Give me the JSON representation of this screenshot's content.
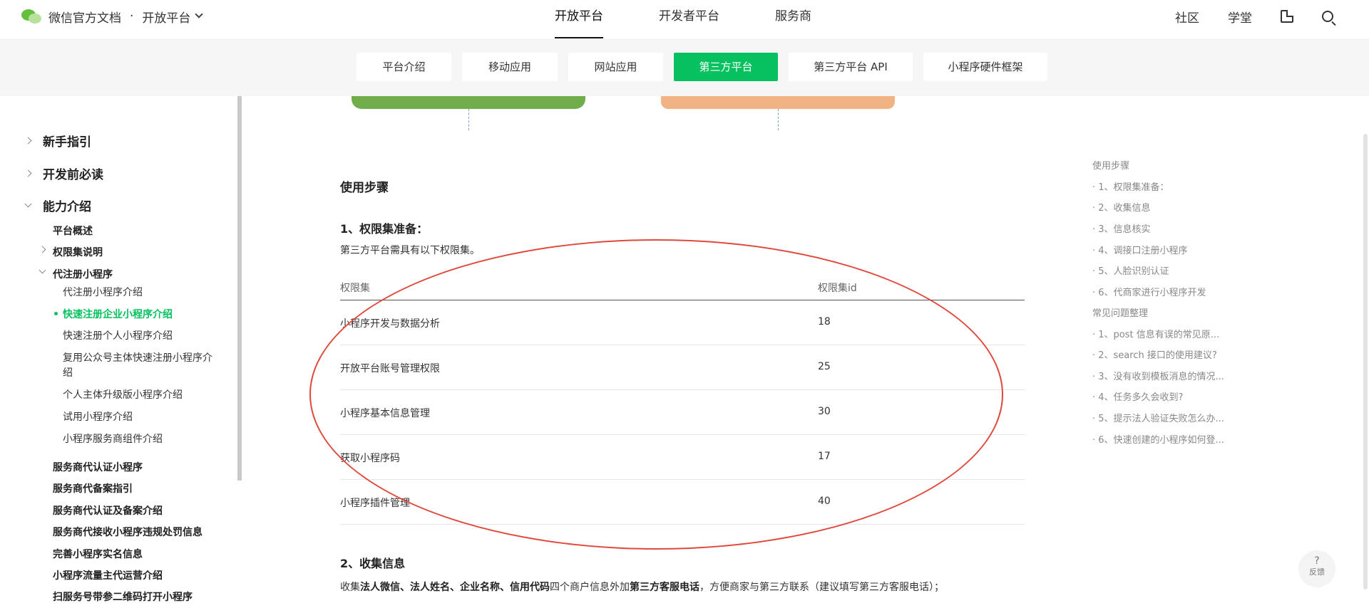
{
  "topnav": {
    "brand": "微信官方文档",
    "separator": "·",
    "platform": "开放平台",
    "main_items": [
      "开放平台",
      "开发者平台",
      "服务商"
    ],
    "right_items": [
      "社区",
      "学堂"
    ]
  },
  "subnav": {
    "tabs": [
      "平台介绍",
      "移动应用",
      "网站应用",
      "第三方平台",
      "第三方平台 API",
      "小程序硬件框架"
    ],
    "active_tab": "第三方平台"
  },
  "sidebar": {
    "top": [
      "新手指引",
      "开发前必读",
      "能力介绍"
    ],
    "ability": [
      "平台概述",
      "权限集说明",
      "代注册小程序"
    ],
    "register_children": [
      "代注册小程序介绍",
      "快速注册企业小程序介绍",
      "快速注册个人小程序介绍",
      "复用公众号主体快速注册小程序介",
      "绍",
      "个人主体升级版小程序介绍",
      "试用小程序介绍",
      "小程序服务商组件介绍"
    ],
    "more": [
      "服务商代认证小程序",
      "服务商代备案指引",
      "服务商代认证及备案介绍",
      "服务商代接收小程序违规处罚信息",
      "完善小程序实名信息",
      "小程序流量主代运营介绍",
      "扫服务号带参二维码打开小程序"
    ]
  },
  "content": {
    "steps_title": "使用步骤",
    "section1_title": "1、权限集准备：",
    "section1_desc": "第三方平台需具有以下权限集。",
    "table": {
      "headers": [
        "权限集",
        "权限集id"
      ],
      "rows": [
        [
          "小程序开发与数据分析",
          "18"
        ],
        [
          "开放平台账号管理权限",
          "25"
        ],
        [
          "小程序基本信息管理",
          "30"
        ],
        [
          "获取小程序码",
          "17"
        ],
        [
          "小程序插件管理",
          "40"
        ]
      ]
    },
    "section2_title": "2、收集信息",
    "section2_desc": {
      "p1": "收集",
      "b1": "法人微信、法人姓名、企业名称、信用代码",
      "p2": "四个商户信息外加",
      "b2": "第三方客服电话",
      "p3": "，方便商家与第三方联系（建议填写第三方客服电话）；"
    }
  },
  "toc": {
    "items": [
      "使用步骤",
      "· 1、权限集准备：",
      "· 2、收集信息",
      "· 3、信息核实",
      "· 4、调接口注册小程序",
      "· 5、人脸识别认证",
      "· 6、代商家进行小程序开发",
      "常见问题整理",
      "· 1、post 信息有误的常见原...",
      "· 2、search 接口的使用建议?",
      "· 3、没有收到模板消息的情况...",
      "· 4、任务多久会收到?",
      "· 5、提示法人验证失败怎么办...",
      "· 6、快速创建的小程序如何登..."
    ]
  },
  "feedback": {
    "icon_text": "?",
    "label": "反馈"
  },
  "colors": {
    "accent": "#07c160",
    "annotation": "#e0483b"
  }
}
